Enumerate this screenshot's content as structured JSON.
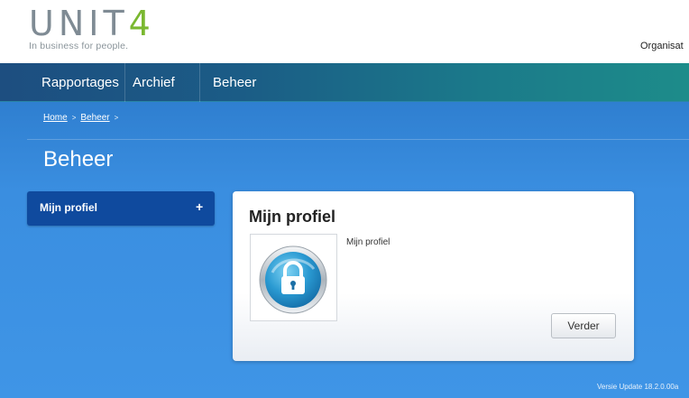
{
  "brand": {
    "logo_main": "UNIT",
    "logo_digit": "4",
    "tagline": "In business for people.",
    "accent_color": "#7ab830"
  },
  "header": {
    "org_text": "Organisat"
  },
  "nav": {
    "items": [
      "Rapportages",
      "Archief",
      "Beheer"
    ]
  },
  "breadcrumb": {
    "home": "Home",
    "beheer": "Beheer",
    "separator": ">"
  },
  "page": {
    "title": "Beheer"
  },
  "sidebar": {
    "items": [
      {
        "label": "Mijn profiel",
        "expand_icon": "+"
      }
    ]
  },
  "card": {
    "title": "Mijn profiel",
    "description": "Mijn profiel",
    "icon": "lock-icon",
    "button_label": "Verder"
  },
  "footer": {
    "version": "Versie Update 18.2.0.00a"
  }
}
